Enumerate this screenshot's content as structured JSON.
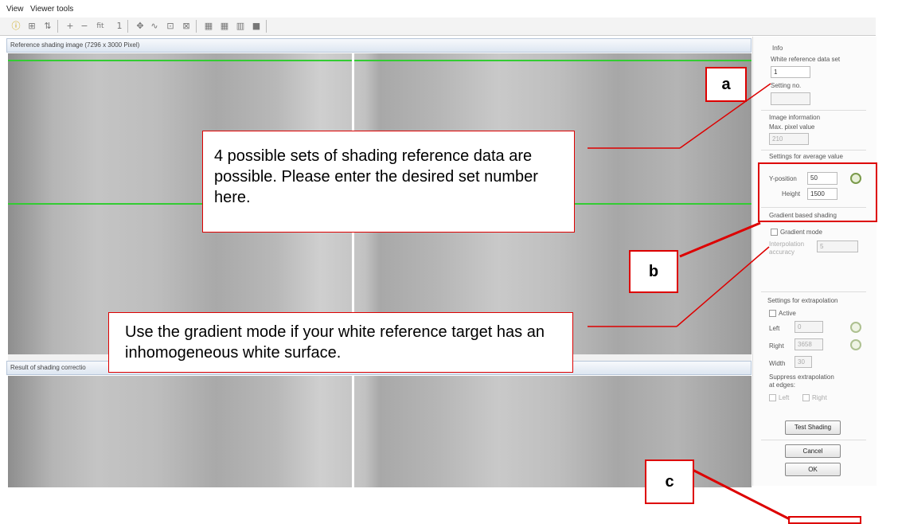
{
  "menu": {
    "view": "View",
    "viewer_tools": "Viewer tools"
  },
  "reference_panel": {
    "title": "Reference shading image (7296 x 3000 Pixel)"
  },
  "result_panel": {
    "title": "Result of shading correctio"
  },
  "info": {
    "heading": "Info",
    "white_ref_label": "White reference data set",
    "white_ref_value": "1",
    "setting_no_label": "Setting no.",
    "setting_no_value": "",
    "image_info_heading": "Image information",
    "max_pixel_label": "Max. pixel value",
    "max_pixel_value": "210",
    "avg_heading": "Settings for average value",
    "y_position_label": "Y-position",
    "y_position_value": "50",
    "height_label": "Height",
    "height_value": "1500",
    "gradient_heading": "Gradient based shading",
    "gradient_mode_label": "Gradient mode",
    "interp_label_1": "Interpolation",
    "interp_label_2": "accuracy",
    "interp_value": "5",
    "extrap_heading": "Settings for extrapolation",
    "active_label": "Active",
    "left_label": "Left",
    "left_value": "0",
    "right_label": "Right",
    "right_value": "3658",
    "width_label": "Width",
    "width_value": "30",
    "suppress_label_1": "Suppress extrapolation",
    "suppress_label_2": "at edges:",
    "suppress_left": "Left",
    "suppress_right": "Right",
    "test_shading": "Test Shading",
    "cancel": "Cancel",
    "ok": "OK"
  },
  "annotations": {
    "callout_a": "4 possible sets of shading reference data are possible. Please enter the desired set number here.",
    "callout_b": "Use the gradient mode if your white reference target has an inhomogeneous white surface.",
    "label_a": "a",
    "label_b": "b",
    "label_c": "c"
  },
  "colors": {
    "annotation": "#dd0000",
    "guide_line": "#33cc33"
  }
}
